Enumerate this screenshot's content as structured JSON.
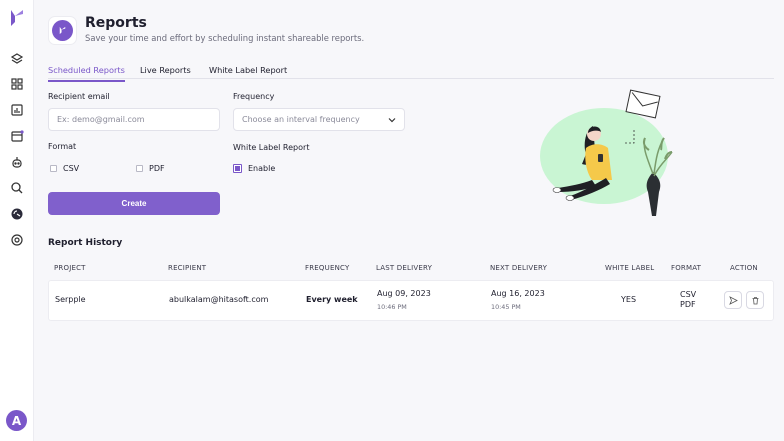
{
  "header": {
    "title": "Reports",
    "subtitle": "Save your time and effort by scheduling instant shareable reports."
  },
  "tabs": [
    {
      "label": "Scheduled Reports",
      "active": true
    },
    {
      "label": "Live Reports",
      "active": false
    },
    {
      "label": "White Label Report",
      "active": false
    }
  ],
  "form": {
    "recipient_label": "Recipient email",
    "recipient_placeholder": "Ex: demo@gmail.com",
    "frequency_label": "Frequency",
    "frequency_placeholder": "Choose an interval frequency",
    "format_label": "Format",
    "format_options": [
      {
        "label": "CSV",
        "checked": false
      },
      {
        "label": "PDF",
        "checked": false
      }
    ],
    "white_label_label": "White Label Report",
    "enable_label": "Enable",
    "enable_checked": true,
    "create_label": "Create"
  },
  "history": {
    "title": "Report History",
    "columns": [
      "PROJECT",
      "RECIPIENT",
      "FREQUENCY",
      "LAST DELIVERY",
      "NEXT DELIVERY",
      "WHITE LABEL",
      "FORMAT",
      "ACTION"
    ],
    "rows": [
      {
        "project": "Serpple",
        "recipient": "abulkalam@hitasoft.com",
        "frequency": "Every week",
        "last_date": "Aug 09, 2023",
        "last_time": "10:46 PM",
        "next_date": "Aug 16, 2023",
        "next_time": "10:45 PM",
        "white_label": "YES",
        "format_1": "CSV",
        "format_2": "PDF"
      }
    ]
  },
  "user": {
    "avatar_initial": "A"
  },
  "icons": [
    "layers-icon",
    "grid-icon",
    "bar-chart-icon",
    "calendar-icon",
    "robot-icon",
    "search-icon",
    "report-icon",
    "settings-icon",
    "send-icon",
    "trash-icon",
    "chevron-down-icon"
  ],
  "colors": {
    "accent": "#7a57c9",
    "button": "#8060cc",
    "illustration_blob": "#c9f5d3"
  }
}
